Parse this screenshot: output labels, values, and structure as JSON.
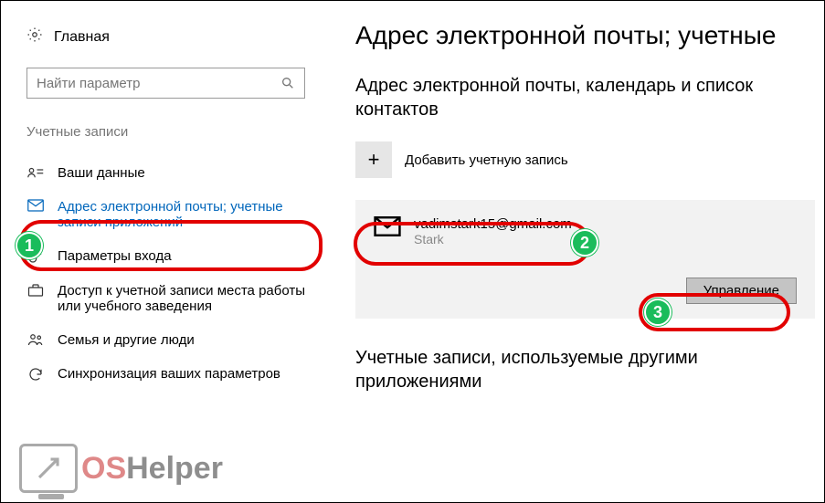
{
  "home_label": "Главная",
  "search": {
    "placeholder": "Найти параметр"
  },
  "section_label": "Учетные записи",
  "nav": {
    "your_data": "Ваши данные",
    "email_accounts": "Адрес электронной почты; учетные записи приложений",
    "signin_options": "Параметры входа",
    "work_access": "Доступ к учетной записи места работы или учебного заведения",
    "family": "Семья и другие люди",
    "sync": "Синхронизация ваших параметров"
  },
  "page_title": "Адрес электронной почты; учетные",
  "subtitle": "Адрес электронной почты, календарь и список контактов",
  "add_account": "Добавить учетную запись",
  "account": {
    "email": "vadimstark15@gmail.com",
    "name": "Stark"
  },
  "manage_label": "Управление",
  "other_apps_title": "Учетные записи, используемые другими приложениями",
  "badges": {
    "one": "1",
    "two": "2",
    "three": "3"
  },
  "watermark": {
    "os": "OS",
    "helper": "Helper"
  }
}
